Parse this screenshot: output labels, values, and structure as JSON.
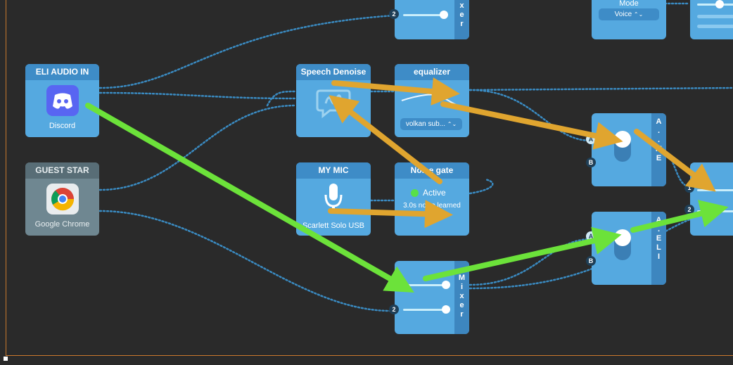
{
  "nodes": {
    "eli_audio_in": {
      "title": "ELI AUDIO IN",
      "app": "Discord"
    },
    "guest_star": {
      "title": "GUEST STAR",
      "app": "Google Chrome"
    },
    "speech_denoise": {
      "title": "Speech Denoise"
    },
    "equalizer": {
      "title": "equalizer",
      "preset": "volkan sub..."
    },
    "my_mic": {
      "title": "MY MIC",
      "device": "Scarlett Solo USB"
    },
    "noise_gate": {
      "title": "Noise gate",
      "status": "Active",
      "detail": "3.0s noise learned"
    },
    "mixer_top": {
      "label": "x e r",
      "input_num": "2"
    },
    "mixer_bottom": {
      "label": "M i x e r",
      "input_num": "2"
    },
    "mode": {
      "label": "Mode",
      "value": "Voice"
    },
    "ab_switch_me": {
      "label": "A . . M E",
      "port_a": "A",
      "port_b": "B"
    },
    "ab_switch_eli": {
      "label": "A . E L I",
      "port_a": "A",
      "port_b": "B"
    },
    "output": {
      "port_1": "1",
      "port_2": "2"
    }
  },
  "colors": {
    "canvas": "#2a2a2a",
    "node": "#55a9e0",
    "node_header": "#3e8cc7",
    "gray_node": "#6f8791",
    "cable": "#3a8bc2",
    "annotation_orange": "#e0a52f",
    "annotation_green": "#6ce23a",
    "active_dot": "#58e04a",
    "discord": "#5865f2"
  },
  "icons": {
    "discord": "discord-icon",
    "chrome": "chrome-icon",
    "microphone": "microphone-icon",
    "speech_denoise": "speech-bubble-icon"
  }
}
